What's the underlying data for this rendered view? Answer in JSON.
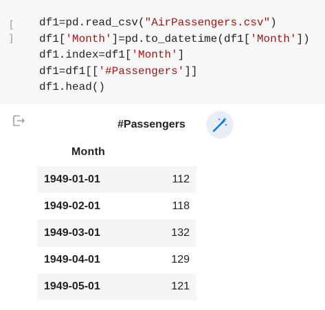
{
  "code_cell": {
    "run_button_glyph": "[ ]",
    "lines": [
      {
        "pre": "df1=pd.read_csv(",
        "str": "\"AirPassengers.csv\"",
        "post": ")"
      },
      {
        "pre": "df1[",
        "str": "'Month'",
        "mid": "]=pd.to_datetime(df1[",
        "str2": "'Month'",
        "post": "])"
      },
      {
        "pre": "df1.index=df1[",
        "str": "'Month'",
        "post": "]"
      },
      {
        "pre": "df1=df1[[",
        "str": "'#Passengers'",
        "post": "]]"
      },
      {
        "pre": "df1.head()"
      }
    ]
  },
  "output": {
    "output_icon": "output-arrow-icon",
    "magic_icon": "magic-wand-icon",
    "column_header": "#Passengers",
    "index_name": "Month",
    "rows": [
      {
        "index": "1949-01-01",
        "value": "112"
      },
      {
        "index": "1949-02-01",
        "value": "118"
      },
      {
        "index": "1949-03-01",
        "value": "132"
      },
      {
        "index": "1949-04-01",
        "value": "129"
      },
      {
        "index": "1949-05-01",
        "value": "121"
      }
    ]
  },
  "colors": {
    "cell_background": "#f7f7f7",
    "string_literal": "#a31515",
    "magic_button_bg": "#e7eef8",
    "magic_icon": "#1a73e8"
  }
}
